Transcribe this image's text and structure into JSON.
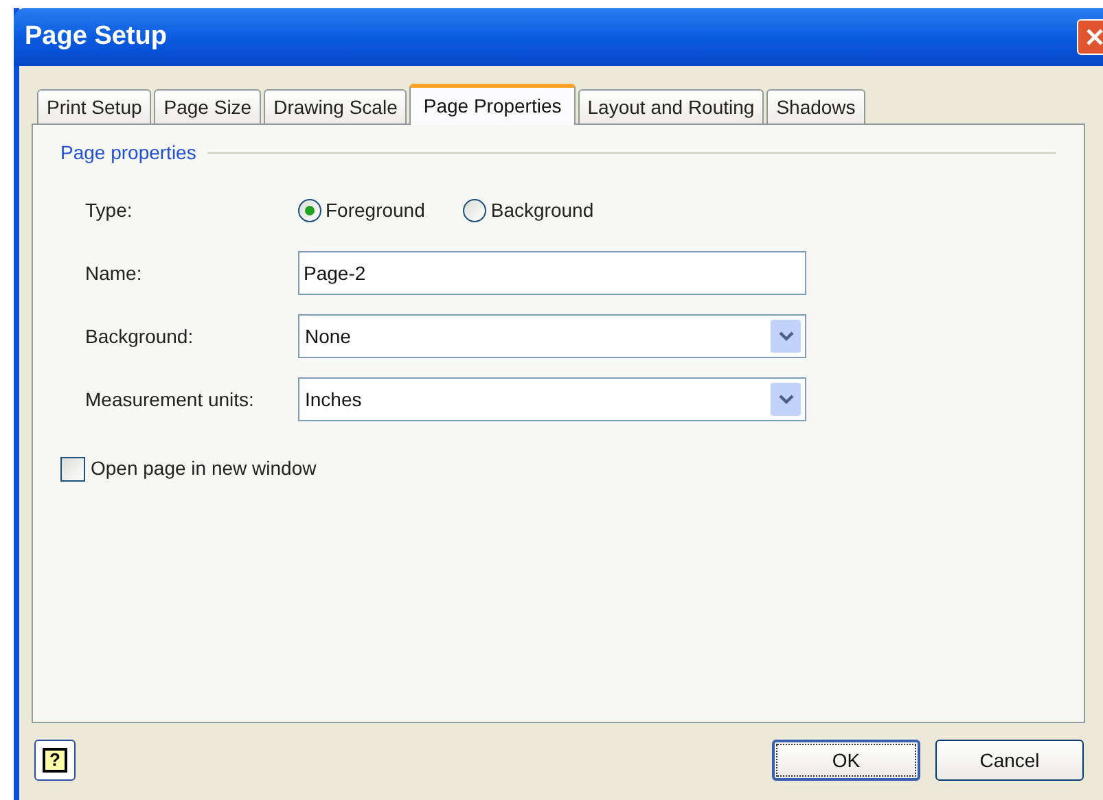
{
  "window": {
    "title": "Page Setup"
  },
  "tabs": [
    {
      "label": "Print Setup",
      "selected": false
    },
    {
      "label": "Page Size",
      "selected": false
    },
    {
      "label": "Drawing Scale",
      "selected": false
    },
    {
      "label": "Page Properties",
      "selected": true
    },
    {
      "label": "Layout and Routing",
      "selected": false
    },
    {
      "label": "Shadows",
      "selected": false
    }
  ],
  "group": {
    "title": "Page properties"
  },
  "fields": [
    {
      "kind": "radio",
      "label": "Type:",
      "options": [
        {
          "label": "Foreground",
          "selected": true
        },
        {
          "label": "Background",
          "selected": false
        }
      ]
    },
    {
      "kind": "text",
      "label": "Name:",
      "value": "Page-2"
    },
    {
      "kind": "dropdown",
      "label": "Background:",
      "value": "None"
    },
    {
      "kind": "dropdown",
      "label": "Measurement units:",
      "value": "Inches"
    }
  ],
  "checkbox": {
    "label": "Open page in new window",
    "checked": false
  },
  "help_button": {
    "label": "?"
  },
  "buttons": [
    {
      "label": "OK",
      "default": true
    },
    {
      "label": "Cancel",
      "default": false
    }
  ]
}
